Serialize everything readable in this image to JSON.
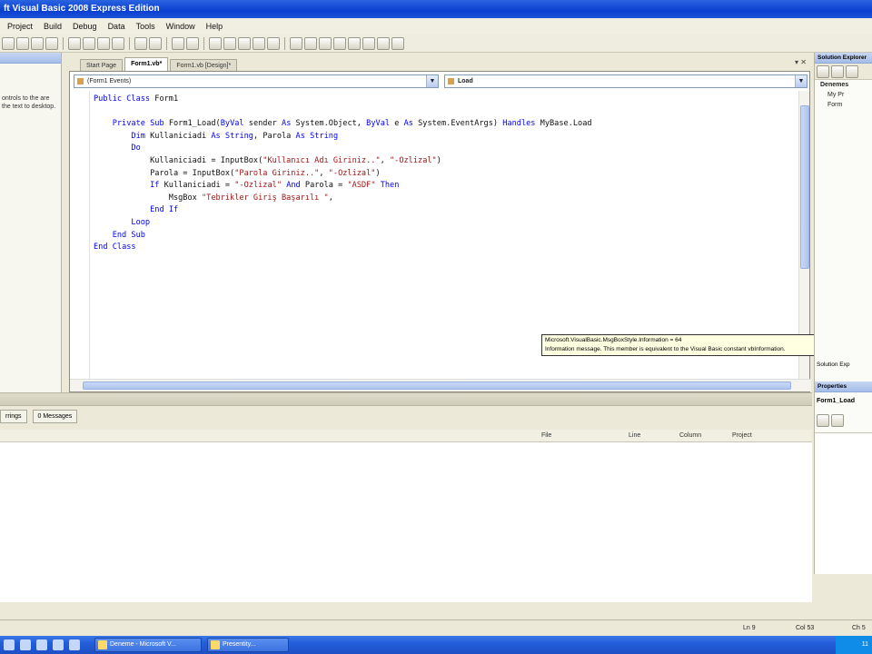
{
  "window": {
    "title": "ft Visual Basic 2008 Express Edition"
  },
  "menu": [
    "Project",
    "Build",
    "Debug",
    "Data",
    "Tools",
    "Window",
    "Help"
  ],
  "toolbox": {
    "hint": "ontrols to the are the text to desktop."
  },
  "tabs": [
    {
      "label": "Start Page",
      "active": false
    },
    {
      "label": "Form1.vb*",
      "active": true
    },
    {
      "label": "Form1.vb [Design]*",
      "active": false
    }
  ],
  "editor": {
    "left_dropdown": "(Form1 Events)",
    "right_dropdown": "Load",
    "code": [
      "Public Class Form1",
      "",
      "    Private Sub Form1_Load(ByVal sender As System.Object, ByVal e As System.EventArgs) Handles MyBase.Load",
      "        Dim Kullaniciadi As String, Parola As String",
      "        Do",
      "            Kullaniciadi = InputBox(\"Kullanıcı Adı Giriniz..\", \"-Ozlizal\")",
      "            Parola = InputBox(\"Parola Giriniz..\", \"-Ozlizal\")",
      "            If Kullaniciadi = \"-Ozlizal\" And Parola = \"ASDF\" Then",
      "                MsgBox \"Tebrikler Giriş Başarılı \",",
      "            End If",
      "        Loop",
      "    End Sub",
      "End Class"
    ]
  },
  "tooltip": {
    "line1": "Microsoft.VisualBasic.MsgBoxStyle.Information = 64",
    "line2": "Information message. This member is equivalent to the Visual Basic constant vbInformation."
  },
  "solution": {
    "title": "Solution Explorer",
    "items": [
      "Denemes",
      "My Pr",
      "Form"
    ],
    "tab_label": "Solution Exp",
    "props_title": "Properties",
    "props_object": "Form1_Load"
  },
  "errlist": {
    "tabs": [
      "rrings",
      "0 Messages"
    ],
    "columns": [
      "File",
      "Line",
      "Column",
      "Project"
    ]
  },
  "status": {
    "ln": "Ln 9",
    "col": "Col 53",
    "ch": "Ch 5"
  },
  "taskbar": {
    "buttons": [
      "Deneme - Microsoft V...",
      "Presentity..."
    ],
    "clock": "11"
  }
}
